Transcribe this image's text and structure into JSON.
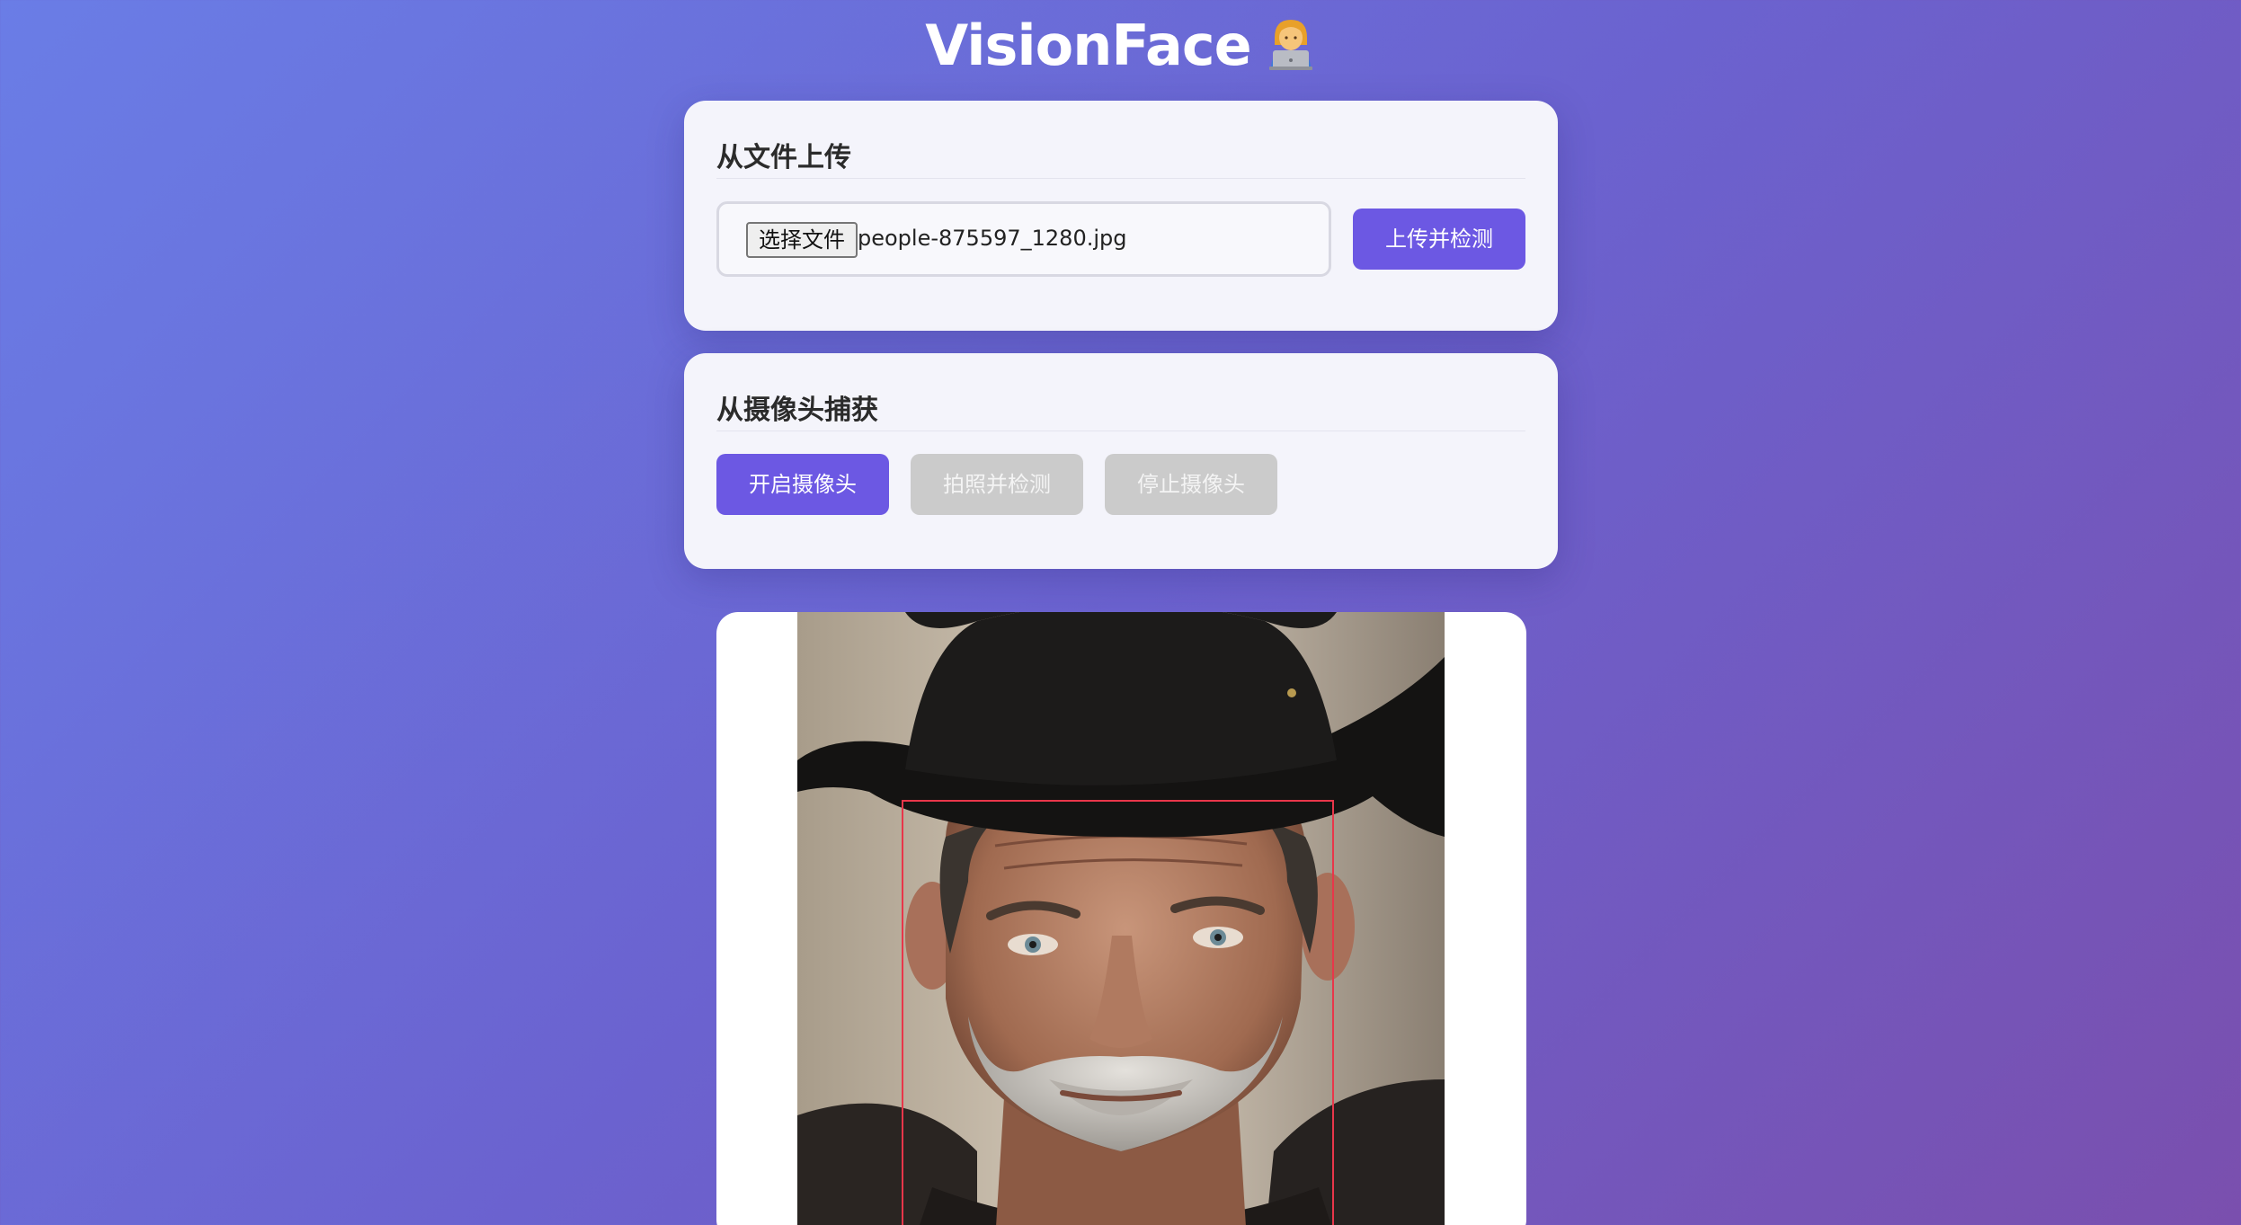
{
  "header": {
    "title": "VisionFace",
    "emoji": "technologist-icon"
  },
  "upload": {
    "heading": "从文件上传",
    "file_button": "选择文件",
    "file_name": "people-875597_1280.jpg",
    "submit_label": "上传并检测"
  },
  "camera": {
    "heading": "从摄像头捕获",
    "start_label": "开启摄像头",
    "capture_label": "拍照并检测",
    "stop_label": "停止摄像头"
  },
  "colors": {
    "accent": "#6c58e3",
    "disabled": "#cbcbcb",
    "detection_box": "#e8364a"
  }
}
